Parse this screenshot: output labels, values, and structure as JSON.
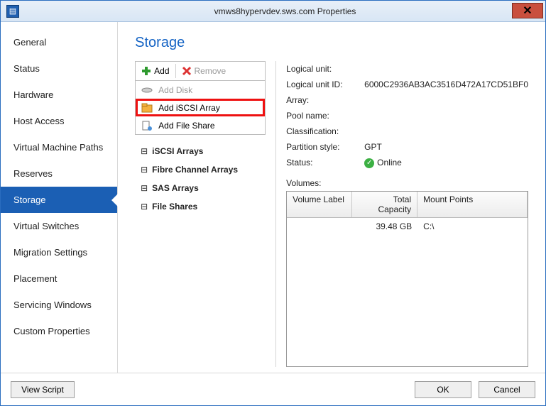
{
  "window": {
    "title": "vmws8hypervdev.sws.com Properties"
  },
  "sidebar": {
    "items": [
      {
        "label": "General"
      },
      {
        "label": "Status"
      },
      {
        "label": "Hardware"
      },
      {
        "label": "Host Access"
      },
      {
        "label": "Virtual Machine Paths"
      },
      {
        "label": "Reserves"
      },
      {
        "label": "Storage"
      },
      {
        "label": "Virtual Switches"
      },
      {
        "label": "Migration Settings"
      },
      {
        "label": "Placement"
      },
      {
        "label": "Servicing Windows"
      },
      {
        "label": "Custom Properties"
      }
    ],
    "selected_index": 6
  },
  "page": {
    "heading": "Storage"
  },
  "toolbar": {
    "add_label": "Add",
    "remove_label": "Remove",
    "add_menu": [
      {
        "label": "Add Disk",
        "icon": "disk-icon",
        "disabled": true
      },
      {
        "label": "Add iSCSI Array",
        "icon": "folder-icon",
        "highlight": true
      },
      {
        "label": "Add File Share",
        "icon": "fileshare-icon"
      }
    ]
  },
  "tree": {
    "nodes": [
      {
        "label": "iSCSI Arrays"
      },
      {
        "label": "Fibre Channel Arrays"
      },
      {
        "label": "SAS Arrays"
      },
      {
        "label": "File Shares"
      }
    ]
  },
  "details": {
    "logical_unit_label": "Logical unit:",
    "logical_unit_value": "",
    "logical_unit_id_label": "Logical unit ID:",
    "logical_unit_id_value": "6000C2936AB3AC3516D472A17CD51BF0",
    "array_label": "Array:",
    "array_value": "",
    "pool_label": "Pool name:",
    "pool_value": "",
    "classification_label": "Classification:",
    "classification_value": "",
    "partition_label": "Partition style:",
    "partition_value": "GPT",
    "status_label": "Status:",
    "status_value": "Online",
    "volumes_label": "Volumes:",
    "columns": {
      "label": "Volume Label",
      "capacity": "Total Capacity",
      "mount": "Mount Points"
    },
    "rows": [
      {
        "label": "",
        "capacity": "39.48 GB",
        "mount": "C:\\"
      }
    ]
  },
  "footer": {
    "view_script": "View Script",
    "ok": "OK",
    "cancel": "Cancel"
  }
}
